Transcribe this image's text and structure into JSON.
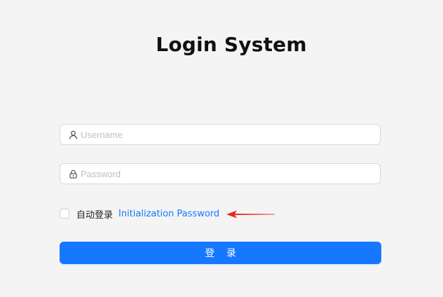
{
  "page": {
    "title": "Login System"
  },
  "form": {
    "username": {
      "icon": "user-icon",
      "placeholder": "Username",
      "value": ""
    },
    "password": {
      "icon": "lock-icon",
      "placeholder": "Password",
      "value": ""
    },
    "remember": {
      "label": "自动登录",
      "checked": false
    },
    "init_link": "Initialization Password",
    "submit_label": "登 录"
  },
  "annotation": {
    "icon": "red-arrow-icon",
    "color": "#e8281e"
  },
  "colors": {
    "background": "#f4f4f4",
    "accent": "#1677ff",
    "placeholder": "#bfbfbf",
    "annotation_arrow": "#e8281e"
  }
}
